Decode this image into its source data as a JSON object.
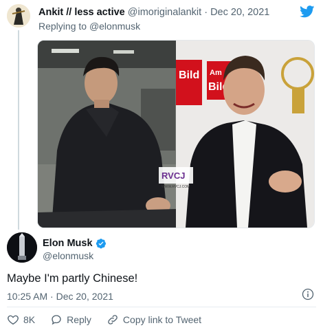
{
  "reply": {
    "author_name": "Ankit // less active",
    "handle": "@imoriginalankit",
    "separator": "·",
    "date": "Dec 20, 2021",
    "replying_prefix": "Replying to",
    "replying_to": "@elonmusk"
  },
  "media": {
    "logo_text": "RVCJ",
    "logo_sub": "WWW.RVCJ.COM",
    "sign_text_1": "Bild",
    "sign_text_2": "Am",
    "sign_text_3": "Bild"
  },
  "tweet": {
    "author_name": "Elon Musk",
    "handle": "@elonmusk",
    "text": "Maybe I'm partly Chinese!",
    "time": "10:25 AM",
    "separator": "·",
    "date": "Dec 20, 2021"
  },
  "actions": {
    "like_count": "8K",
    "reply_label": "Reply",
    "copy_label": "Copy link to Tweet"
  },
  "colors": {
    "twitter_blue": "#1d9bf0",
    "secondary_text": "#536471",
    "verified": "#1d9bf0"
  },
  "icons": [
    "twitter-bird-icon",
    "verified-badge-icon",
    "info-icon",
    "heart-icon",
    "reply-bubble-icon",
    "link-icon"
  ]
}
